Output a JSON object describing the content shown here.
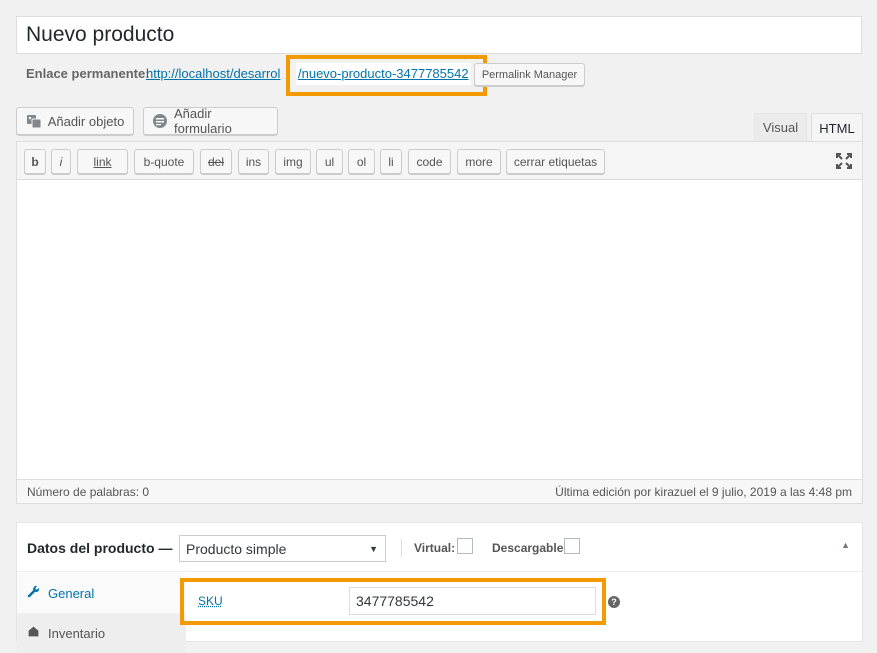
{
  "post": {
    "title": "Nuevo producto"
  },
  "permalink": {
    "label": "Enlace permanente:",
    "base_url": "http://localhost/desarrol",
    "slug": "/nuevo-producto-3477785542",
    "manager_button": "Permalink Manager"
  },
  "media_buttons": {
    "add_object": "Añadir objeto",
    "add_form": "Añadir formulario"
  },
  "editor_tabs": {
    "visual": "Visual",
    "html": "HTML"
  },
  "quicktags": [
    "b",
    "i",
    "link",
    "b-quote",
    "del",
    "ins",
    "img",
    "ul",
    "ol",
    "li",
    "code",
    "more",
    "cerrar etiquetas"
  ],
  "status_bar": {
    "word_count": "Número de palabras: 0",
    "last_edit": "Última edición por kirazuel el 9 julio, 2019 a las 4:48 pm"
  },
  "product_data": {
    "title": "Datos del producto —",
    "product_type": "Producto simple",
    "virtual_label": "Virtual:",
    "downloadable_label": "Descargable:",
    "nav": {
      "general": "General",
      "inventory": "Inventario"
    },
    "sku_label": "SKU",
    "sku_value": "3477785542"
  },
  "colors": {
    "highlight": "#f29a00",
    "link": "#0073aa"
  }
}
